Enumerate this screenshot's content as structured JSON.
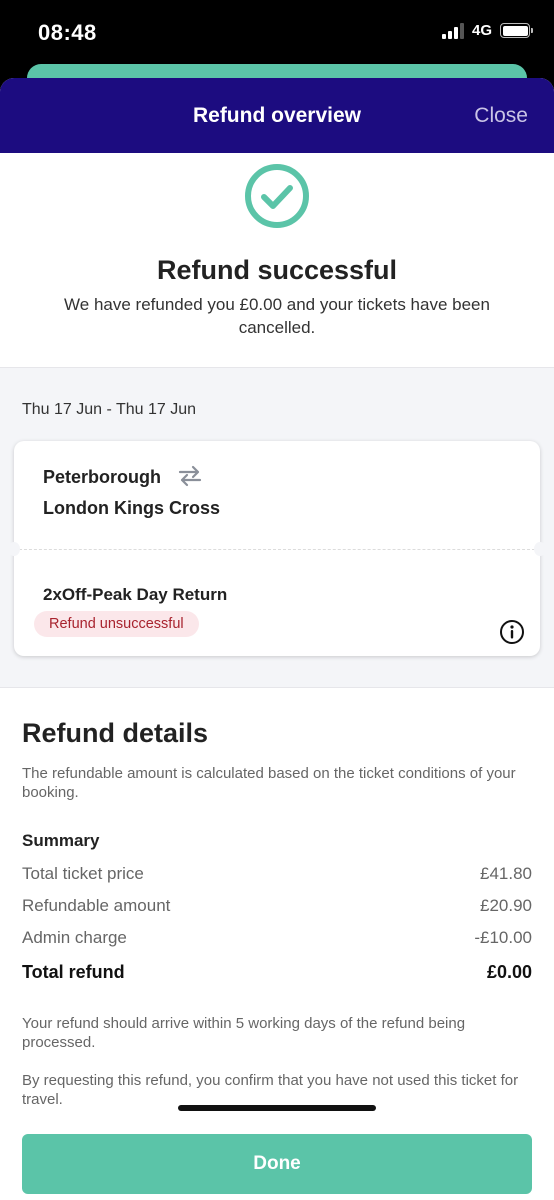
{
  "status_bar": {
    "time": "08:48",
    "network": "4G"
  },
  "header": {
    "title": "Refund overview",
    "close_label": "Close"
  },
  "success": {
    "title": "Refund successful",
    "message": "We have refunded you £0.00 and your tickets have been cancelled."
  },
  "journey": {
    "date_range": "Thu 17 Jun - Thu 17 Jun",
    "from": "Peterborough",
    "to": "London Kings Cross",
    "ticket_type": "2xOff-Peak Day Return",
    "refund_status": "Refund unsuccessful"
  },
  "refund_details": {
    "title": "Refund details",
    "subtitle": "The refundable amount is calculated based on the ticket conditions of your booking.",
    "summary_label": "Summary",
    "rows": [
      {
        "label": "Total ticket price",
        "value": "£41.80"
      },
      {
        "label": "Refundable amount",
        "value": "£20.90"
      },
      {
        "label": "Admin charge",
        "value": "-£10.00"
      }
    ],
    "total": {
      "label": "Total refund",
      "value": "£0.00"
    },
    "note_arrival": "Your refund should arrive within 5 working days of the refund being processed.",
    "note_confirm": "By requesting this refund, you confirm that you have not used this ticket for travel."
  },
  "done_label": "Done",
  "colors": {
    "header": "#1c0c80",
    "accent": "#5bc4a8",
    "error_bg": "#fbe7ea",
    "error_text": "#a8232e"
  },
  "icons": {
    "success": "check-circle-icon",
    "swap": "swap-arrows-icon",
    "info": "info-icon"
  }
}
